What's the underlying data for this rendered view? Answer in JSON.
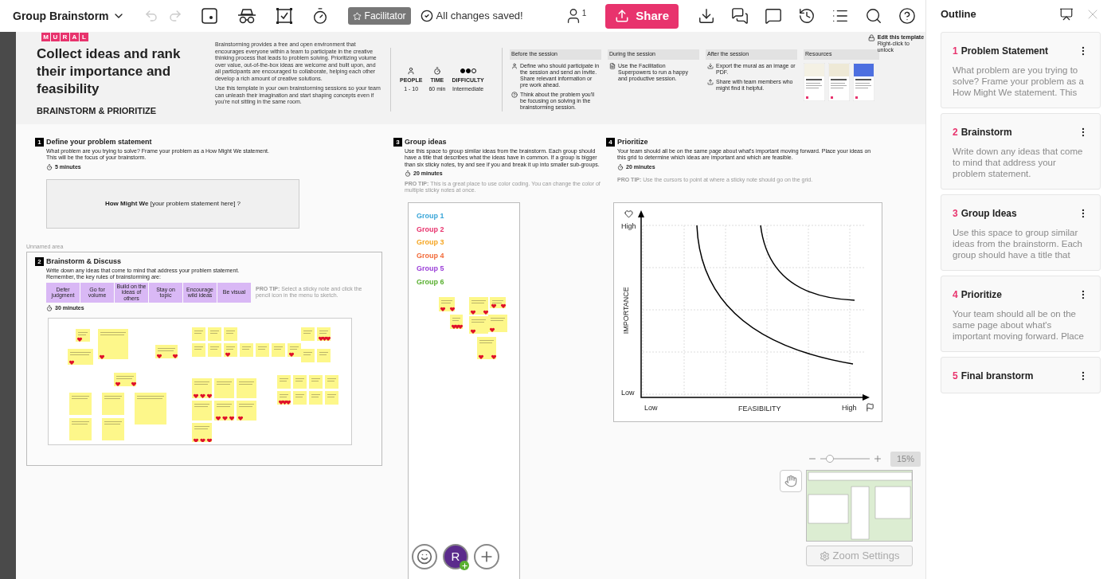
{
  "toolbar": {
    "board_title": "Group Brainstorm",
    "undo": {
      "disabled": true
    },
    "redo": {
      "disabled": true
    },
    "facilitator_badge": "Facilitator",
    "save_status": "All changes saved!",
    "participants_count": "1",
    "share_label": "Share"
  },
  "header": {
    "logo_letters": [
      "M",
      "U",
      "R",
      "A",
      "L"
    ],
    "title": "Collect ideas and rank their importance and feasibility",
    "subtitle": "BRAINSTORM & PRIORITIZE",
    "description": [
      "Brainstorming provides a free and open environment that encourages everyone within a team to participate in the creative thinking process that leads to problem solving. Prioritizing volume over value, out-of-the-box ideas are welcome and built upon, and all participants are encouraged to collaborate, helping each other develop a rich amount of creative solutions.",
      "Use this template in your own brainstorming sessions so your team can unleash their imagination and start shaping concepts even if you're not sitting in the same room."
    ],
    "stats": [
      {
        "kind": "people",
        "label": "PEOPLE",
        "value": "1 - 10"
      },
      {
        "kind": "time",
        "label": "TIME",
        "value": "60 min"
      },
      {
        "kind": "difficulty",
        "label": "DIFFICULTY",
        "value": "Intermediate",
        "stars": 2
      }
    ],
    "session_columns": [
      {
        "heading": "Before the session",
        "steps": [
          {
            "kind": "person",
            "text": "Define who should participate in the session and send an invite. Share relevant information or pre work ahead."
          },
          {
            "kind": "question",
            "text": "Think about the problem you'll be focusing on solving in the brainstorming session."
          }
        ]
      },
      {
        "heading": "During the session",
        "steps": [
          {
            "kind": "document",
            "text": "Use the Facilitation Superpowers to run a happy and productive session."
          }
        ]
      },
      {
        "heading": "After the session",
        "steps": [
          {
            "kind": "download",
            "text": "Export the mural as an image or PDF."
          },
          {
            "kind": "upload",
            "text": "Share with team members who might find it helpful."
          }
        ]
      }
    ],
    "resources_heading": "Resources",
    "lock_note": {
      "title": "Edit this template",
      "hint": "Right-click to unlock"
    }
  },
  "define": {
    "number": "1",
    "title": "Define your problem statement",
    "description": [
      "What problem are you trying to solve? Frame your problem as a How Might We statement.",
      "This will be the focus of your brainstorm."
    ],
    "duration": "5 minutes",
    "statement": "**How Might We** [your problem statement here] ?"
  },
  "brainstorm": {
    "area_label": "Unnamed area",
    "number": "2",
    "title": "Brainstorm & Discuss",
    "description": [
      "Write down any ideas that come to mind that address your problem statement.",
      "Remember, the key rules of brainstorming are:"
    ],
    "rules": [
      "Defer judgment",
      "Go for volume",
      "Build on the ideas of others",
      "Stay on topic",
      "Encourage wild ideas",
      "Be visual"
    ],
    "pro_tip": "**PRO TIP:** Select a sticky note and click the pencil icon in the menu to sketch.",
    "duration": "30 minutes"
  },
  "group_ideas": {
    "number": "3",
    "title": "Group ideas",
    "description": "Use this space to group similar ideas from the brainstorm. Each group should have a title that describes what the ideas have in common. If a group is bigger than six sticky notes, try and see if you and break it up into smaller sub-groups.",
    "duration": "20 minutes",
    "pro_tip": "**PRO TIP:** This is a great place to use color coding. You can change the color of multiple sticky notes at once.",
    "groups": [
      {
        "label": "Group 1",
        "color": "#3aa6d8"
      },
      {
        "label": "Group 2",
        "color": "#e8336d"
      },
      {
        "label": "Group 3",
        "color": "#f5a623"
      },
      {
        "label": "Group 4",
        "color": "#f26b3a"
      },
      {
        "label": "Group 5",
        "color": "#9b3fd8"
      },
      {
        "label": "Group 6",
        "color": "#5ab031"
      }
    ]
  },
  "prioritize": {
    "number": "4",
    "title": "Prioritize",
    "description": "Your team should all be on the same page about what's important moving forward. Place your ideas on this grid to determine which ideas are important and which are feasible.",
    "duration": "20 minutes",
    "pro_tip": "**PRO TIP:** Use the cursors to point at where a sticky note should go on the grid.",
    "grid": {
      "y_high": "High",
      "y_low": "Low",
      "y_label": "IMPORTANCE",
      "x_low": "Low",
      "x_high": "High",
      "x_label": "FEASIBILITY"
    }
  },
  "canvas_controls": {
    "zoom_level": "15%",
    "zoom_slider": {
      "level": 0.2
    },
    "zoom_settings": "Zoom Settings",
    "avatar_initial": "R"
  },
  "outline": {
    "title": "Outline",
    "items": [
      {
        "number": "1",
        "title": "Problem Statement",
        "description": "What problem are you trying to solve? Frame your problem as a How Might We statement. This"
      },
      {
        "number": "2",
        "title": "Brainstorm",
        "description": "Write down any ideas that come to mind that address your problem statement."
      },
      {
        "number": "3",
        "title": "Group Ideas",
        "description": "Use this space to group similar ideas from the brainstorm. Each group should have a title that"
      },
      {
        "number": "4",
        "title": "Prioritize",
        "description": "Your team should all be on the same page about what's important moving forward. Place"
      },
      {
        "number": "5",
        "title": "Final branstorm"
      }
    ]
  }
}
